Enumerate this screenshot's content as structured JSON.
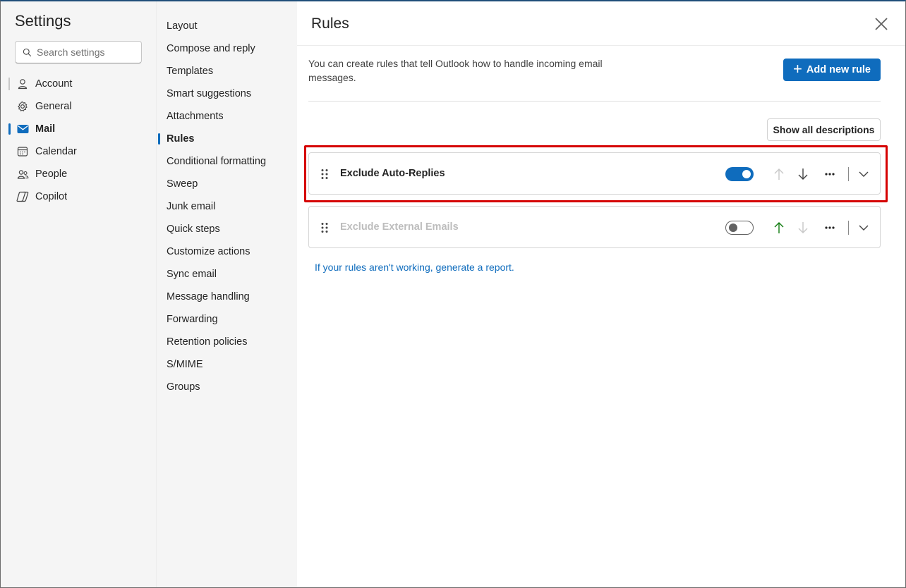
{
  "sidebar": {
    "title": "Settings",
    "search_placeholder": "Search settings",
    "items": [
      {
        "label": "Account",
        "icon": "person-icon"
      },
      {
        "label": "General",
        "icon": "gear-icon"
      },
      {
        "label": "Mail",
        "icon": "mail-icon",
        "active": true
      },
      {
        "label": "Calendar",
        "icon": "calendar-icon"
      },
      {
        "label": "People",
        "icon": "people-icon"
      },
      {
        "label": "Copilot",
        "icon": "copilot-icon"
      }
    ]
  },
  "mail_nav": {
    "items": [
      "Layout",
      "Compose and reply",
      "Templates",
      "Smart suggestions",
      "Attachments",
      "Rules",
      "Conditional formatting",
      "Sweep",
      "Junk email",
      "Quick steps",
      "Customize actions",
      "Sync email",
      "Message handling",
      "Forwarding",
      "Retention policies",
      "S/MIME",
      "Groups"
    ],
    "active": "Rules"
  },
  "rules_page": {
    "title": "Rules",
    "description": "You can create rules that tell Outlook how to handle incoming email messages.",
    "add_rule_label": "Add new rule",
    "show_descriptions_label": "Show all descriptions",
    "rules": [
      {
        "name": "Exclude Auto-Replies",
        "enabled": true
      },
      {
        "name": "Exclude External Emails",
        "enabled": false
      }
    ],
    "report_link": "If your rules aren't working, generate a report."
  },
  "colors": {
    "accent": "#0f6cbd",
    "highlight_border": "#d50000",
    "up_arrow_active": "#0e7a0d"
  }
}
